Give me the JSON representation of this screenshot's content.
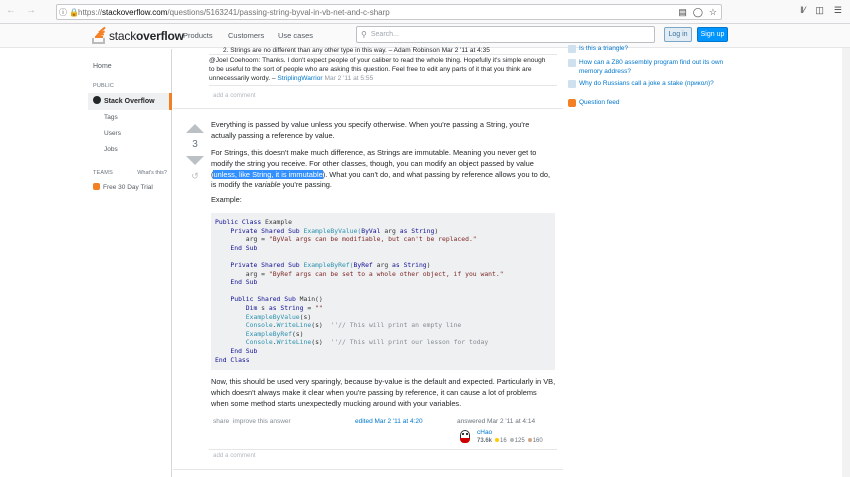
{
  "browser": {
    "url_prefix": "https://",
    "url_host": "stackoverflow.com",
    "url_path": "/questions/5163241/passing-string-byval-in-vb-net-and-c-sharp"
  },
  "header": {
    "logo_plain": "stack",
    "logo_bold": "overflow",
    "nav": [
      "Products",
      "Customers",
      "Use cases"
    ],
    "search_placeholder": "Search...",
    "login": "Log in",
    "signup": "Sign up"
  },
  "leftbar": {
    "home": "Home",
    "public_label": "PUBLIC",
    "active": "Stack Overflow",
    "items": [
      "Tags",
      "Users",
      "Jobs"
    ],
    "teams_label": "TEAMS",
    "whats_this": "What's this?",
    "trial": "Free 30 Day Trial"
  },
  "comments": {
    "top_cut": "2. Strings are no different than any other type in this way. – Adam Robinson Mar 2 '11 at 4:35",
    "comment1_text": "@Joel Coehoorn: Thanks. I don't expect people of your caliber to read the whole thing. Hopefully it's simple enough to be useful to the sort of people who are asking this question. Feel free to edit any parts of it that you think are unnecessarily wordy. –",
    "comment1_user": "StriplingWarrior",
    "comment1_date": "Mar 2 '11 at 5:55",
    "add_comment": "add a comment"
  },
  "answer": {
    "votes": "3",
    "p1": "Everything is passed by value unless you specify otherwise. When you're passing a String, you're actually passing a reference by value.",
    "p2_a": "For Strings, this doesn't make much difference, as Strings are immutable. Meaning you never get to modify the string you receive. For other classes, though, you can modify an object passed by value (",
    "p2_hl": "unless, like String, it is immutable",
    "p2_b": "). What you can't do, and what passing by reference allows you to do, is modify the ",
    "p2_em": "variable",
    "p2_c": " you're passing.",
    "p3": "Example:",
    "p4": "Now, this should be used very sparingly, because by-value is the default and expected. Particularly in VB, which doesn't always make it clear when you're passing by reference, it can cause a lot of problems when some method starts unexpectedly mucking around with your variables.",
    "share": "share",
    "improve": "improve this answer",
    "edited": "edited Mar 2 '11 at 4:20",
    "answered": "answered Mar 2 '11 at 4:14",
    "user": "cHao",
    "rep": "73.6k",
    "gold": "16",
    "silver": "125",
    "bronze": "160",
    "add_comment": "add a comment"
  },
  "code": {
    "l1_kw": "Public Class",
    "l1_n": " Example",
    "l2_kw": "Private Shared Sub",
    "l2_fn": " ExampleByValue(",
    "l2_kw2": "ByVal",
    "l2_n": " arg ",
    "l2_kw3": "as String",
    "l2_e": ")",
    "l3_n": "arg = ",
    "l3_s": "\"ByVal args can be modifiable, but can't be replaced.\"",
    "l4_kw": "End Sub",
    "l6_kw": "Private Shared Sub",
    "l6_fn": " ExampleByRef(",
    "l6_kw2": "ByRef",
    "l6_n": " arg ",
    "l6_kw3": "as String",
    "l6_e": ")",
    "l7_n": "arg = ",
    "l7_s": "\"ByRef args can be set to a whole other object, if you want.\"",
    "l8_kw": "End Sub",
    "l10_kw": "Public Shared Sub",
    "l10_n": " Main()",
    "l11_kw": "Dim",
    "l11_n": " s ",
    "l11_kw2": "as String",
    "l11_e": " = ",
    "l11_s": "\"\"",
    "l12_fn": "ExampleByValue",
    "l12_n": "(s)",
    "l13_fn": "Console",
    "l13_n": ".",
    "l13_fn2": "WriteLine",
    "l13_n2": "(s)  ",
    "l13_cm": "''// This will print an empty line",
    "l14_fn": "ExampleByRef",
    "l14_n": "(s)",
    "l15_fn": "Console",
    "l15_n": ".",
    "l15_fn2": "WriteLine",
    "l15_n2": "(s)  ",
    "l15_cm": "''// This will print our lesson for today",
    "l16_kw": "End Sub",
    "l17_kw": "End Class"
  },
  "rightbar": {
    "links": [
      "Is this a triangle?",
      "How can a Z80 assembly program find out its own memory address?",
      "Why do Russians call a joke a stake (прикол)?"
    ],
    "feed": "Question feed"
  }
}
